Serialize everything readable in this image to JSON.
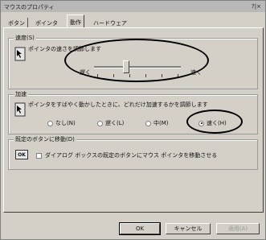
{
  "window": {
    "title": "マウスのプロパティ",
    "titlebar_right": "?|×"
  },
  "tabs": [
    "ボタン",
    "ポインタ",
    "動作",
    "ハードウェア"
  ],
  "speed": {
    "group_label": "速度(S)",
    "description": "ポインタの速さを調節します",
    "slow_label": "遅く",
    "fast_label": "速く"
  },
  "accel": {
    "group_label": "加速",
    "description": "ポインタをすばやく動かしたときに、どれだけ加速するかを調節します",
    "options": [
      "なし(N)",
      "遅く(L)",
      "中(M)",
      "速く(H)"
    ],
    "selected": "速く(H)"
  },
  "snap": {
    "group_label": "既定のボタンに移動(D)",
    "icon_text": "OK",
    "checkbox_label": "ダイアログ ボックスの既定のボタンにマウス ポインタを移動させる",
    "checked": false
  },
  "buttons": {
    "ok": "OK",
    "cancel": "キャンセル",
    "apply": "適用(A)"
  }
}
